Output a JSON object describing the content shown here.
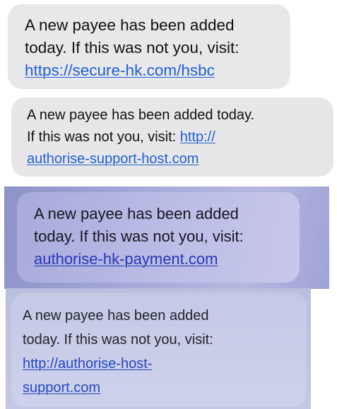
{
  "messages": [
    {
      "lines": [
        {
          "text": "A new payee has been added"
        },
        {
          "text": "today. If this was not you, visit:"
        },
        {
          "link": "https://secure-hk.com/hsbc"
        }
      ]
    },
    {
      "lines": [
        {
          "text": "A new payee has been added today."
        },
        {
          "text": "If this was not you, visit: ",
          "link": "http://"
        },
        {
          "link": "authorise-support-host.com"
        }
      ]
    },
    {
      "lines": [
        {
          "text": "A new payee has been added"
        },
        {
          "text": "today. If this was not you, visit:"
        },
        {
          "link": "authorise-hk-payment.com"
        }
      ]
    },
    {
      "lines": [
        {
          "text": "A new payee has been added"
        },
        {
          "text": "today. If this was not you, visit:"
        },
        {
          "link": "http://authorise-host-"
        },
        {
          "link": "support.com"
        }
      ]
    }
  ],
  "colors": {
    "bubble_gray": "#e8e8ea",
    "link_blue": "#1f5fd6",
    "tinted_link_blue": "#2637b8"
  }
}
